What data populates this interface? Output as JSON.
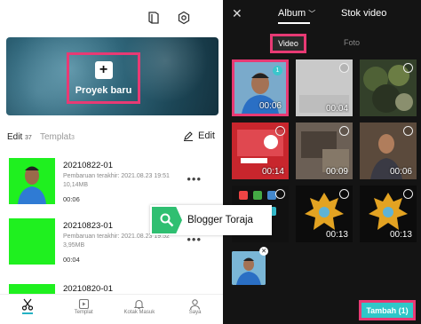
{
  "home": {
    "new_project_label": "Proyek baru",
    "tab_edit": "Edit",
    "tab_edit_count": "37",
    "tab_template": "Templat",
    "tab_template_count": "3",
    "edit_button": "Edit"
  },
  "projects": [
    {
      "name": "20210822-01",
      "updated": "Pembaruan terakhir: 2021.08.23 19:51",
      "size": "10,14MB",
      "duration": "00:06"
    },
    {
      "name": "20210823-01",
      "updated": "Pembaruan terakhir: 2021.08.23 19:52",
      "size": "3,95MB",
      "duration": "00:04"
    },
    {
      "name": "20210820-01"
    }
  ],
  "bottom_nav": [
    {
      "label": "",
      "icon": "scissors-icon"
    },
    {
      "label": "Templat",
      "icon": "template-icon"
    },
    {
      "label": "Kotak Masuk",
      "icon": "bell-icon"
    },
    {
      "label": "Saya",
      "icon": "user-icon"
    }
  ],
  "watermark": {
    "text": "Blogger Toraja"
  },
  "picker": {
    "tab_album": "Album",
    "tab_stock": "Stok video",
    "seg_video": "Video",
    "seg_photo": "Foto",
    "add_button": "Tambah (1)",
    "selected_number": "1",
    "durations": [
      "00:06",
      "00:04",
      "",
      "00:14",
      "00:09",
      "00:06",
      "",
      "00:13",
      "00:13"
    ]
  }
}
